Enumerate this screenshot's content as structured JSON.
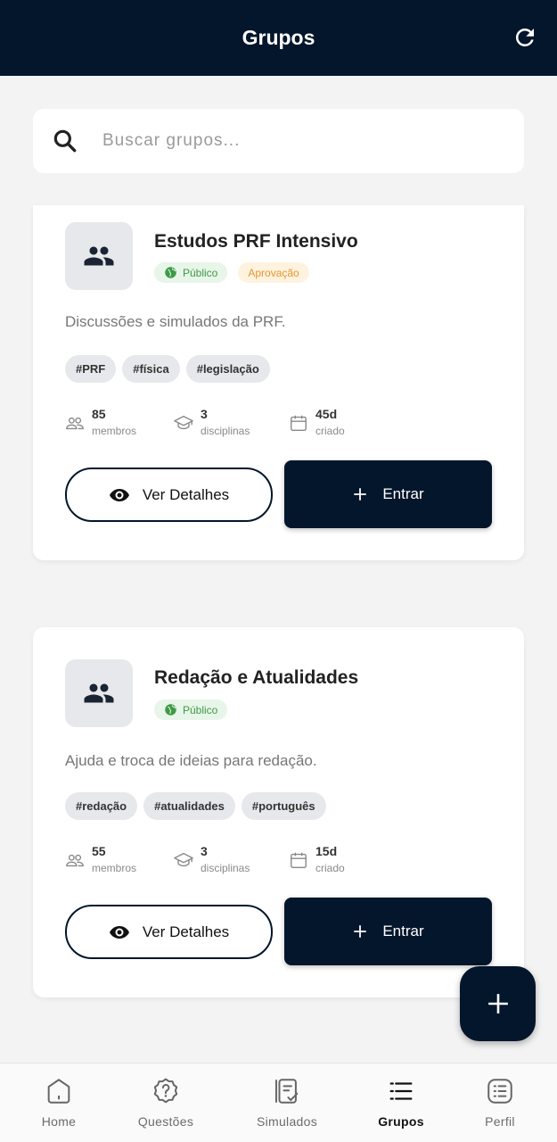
{
  "appbar": {
    "title": "Grupos"
  },
  "search": {
    "placeholder": "Buscar grupos..."
  },
  "groups": [
    {
      "title": "Estudos PRF Intensivo",
      "badges": [
        "Público",
        "Aprovação"
      ],
      "description": "Discussões e simulados da PRF.",
      "tags": [
        "#PRF",
        "#física",
        "#legislação"
      ],
      "members": "85",
      "members_label": "membros",
      "disciplines": "3",
      "disciplines_label": "disciplinas",
      "created": "45d",
      "created_label": "criado",
      "details_label": "Ver Detalhes",
      "join_label": "Entrar"
    },
    {
      "title": "Redação e Atualidades",
      "badges": [
        "Público"
      ],
      "description": "Ajuda e troca de ideias para redação.",
      "tags": [
        "#redação",
        "#atualidades",
        "#português"
      ],
      "members": "55",
      "members_label": "membros",
      "disciplines": "3",
      "disciplines_label": "disciplinas",
      "created": "15d",
      "created_label": "criado",
      "details_label": "Ver Detalhes",
      "join_label": "Entrar"
    }
  ],
  "bottom_nav": [
    {
      "label": "Home",
      "icon": "home-icon"
    },
    {
      "label": "Questões",
      "icon": "help-icon"
    },
    {
      "label": "Simulados",
      "icon": "notebook-icon"
    },
    {
      "label": "Grupos",
      "icon": "list-icon",
      "active": true
    },
    {
      "label": "Perfil",
      "icon": "profile-list-icon"
    }
  ],
  "colors": {
    "primary": "#04162b",
    "public_green": "#3e9a47",
    "approval_orange": "#e6962b"
  }
}
